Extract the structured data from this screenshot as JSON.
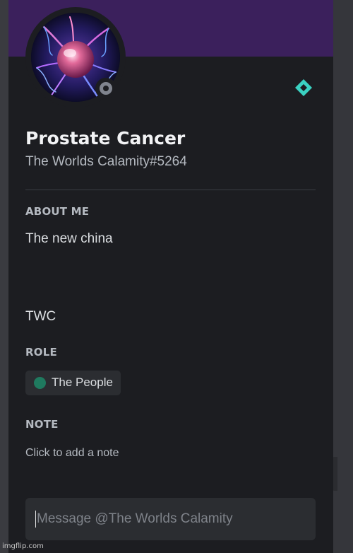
{
  "profile": {
    "display_name": "Prostate Cancer",
    "username": "The Worlds Calamity#5264",
    "status": "offline",
    "badge_icon": "nitro-diamond-icon",
    "banner_color": "#3b205c",
    "badge_color": "#3ad2c2"
  },
  "about": {
    "title": "ABOUT ME",
    "lines": [
      "The new china",
      "TWC"
    ]
  },
  "roles": {
    "title": "ROLE",
    "items": [
      {
        "name": "The People",
        "color": "#1f7a5f"
      }
    ]
  },
  "note": {
    "title": "NOTE",
    "placeholder": "Click to add a note"
  },
  "message": {
    "placeholder": "Message @The Worlds Calamity"
  },
  "watermark": "imgflip.com"
}
